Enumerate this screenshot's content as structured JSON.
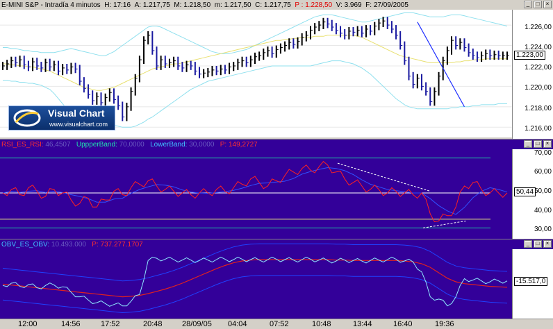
{
  "price_header": {
    "symbol": "E-MINI S&P - Intradía 4 minutos",
    "h_label": "H:",
    "h_val": "17:16",
    "a_label": "A:",
    "a_val": "1.217,75",
    "m_label": "M:",
    "m_val": "1.218,50",
    "mm_label": "m:",
    "mm_val": "1.217,50",
    "c_label": "C:",
    "c_val": "1.217,75",
    "p_label": "P :",
    "p_val": "1.228,50",
    "v_label": "V:",
    "v_val": "3.969",
    "f_label": "F:",
    "f_val": "27/09/2005"
  },
  "rsi_header": {
    "name": "RSI_ES_RSI:",
    "name_val": "46,4507",
    "upper": "UppperBand:",
    "upper_val": "70,0000",
    "lower": "LowerBand:",
    "lower_val": "30,0000",
    "p_label": "P:",
    "p_val": "149,2727"
  },
  "obv_header": {
    "name": "OBV_ES_OBV:",
    "name_val": "10.493.000",
    "p_label": "P:",
    "p_val": "737.277.1707"
  },
  "price_axis": [
    "1.226,00",
    "1.224,00",
    "1.222,00",
    "1.220,00",
    "1.218,00",
    "1.216,00"
  ],
  "rsi_axis": [
    "70,00",
    "60,00",
    "50,00",
    "40,00",
    "30,00"
  ],
  "price_current": "1.223,00",
  "rsi_current": "50,44",
  "obv_current": "-15.517,0",
  "x_labels": [
    "12:00",
    "14:56",
    "17:52",
    "20:48",
    "28/09/05",
    "04:04",
    "07:52",
    "10:48",
    "13:44",
    "16:40",
    "19:36"
  ],
  "logo": {
    "title": "Visual Chart",
    "url": "www.visualchart.com"
  },
  "window_buttons": [
    "_",
    "□",
    "×"
  ],
  "colors": {
    "price_bg": "#ffffff",
    "indicator_bg": "#330099",
    "price_bars": "#1a1aa0",
    "price_bars_up": "#000000",
    "bollinger": "#8fe0ee",
    "ma_yellow": "#e8e070",
    "rsi_line": "#ff2020",
    "rsi_band": "#20c0a0",
    "rsi_level": "#ffff80",
    "obv_line": "#8fe8ff",
    "obv_ma": "#e02020",
    "obv_env": "#2040ff"
  },
  "chart_data": [
    {
      "type": "line",
      "panel": "price",
      "ylim": [
        1215,
        1227.5
      ],
      "x": [
        0,
        6,
        12,
        18,
        24,
        30,
        36,
        42,
        48,
        54,
        60,
        66,
        72,
        78,
        84,
        90,
        96,
        102,
        108,
        114,
        120,
        126,
        132,
        138,
        144,
        150,
        156,
        162,
        168,
        174,
        180,
        186,
        192,
        198,
        204,
        210,
        216,
        222,
        228,
        234,
        240,
        246,
        252,
        258,
        264,
        270,
        276,
        282,
        288,
        294,
        300,
        306,
        312,
        318,
        324,
        330,
        336,
        342,
        348,
        354,
        360,
        366,
        372,
        378,
        384,
        390,
        396,
        402,
        408,
        414,
        420,
        426,
        432,
        438,
        444,
        450,
        456,
        462,
        468,
        474,
        480,
        486,
        492,
        498,
        504,
        510,
        516,
        522,
        528,
        534,
        540,
        546,
        552,
        558,
        564,
        570,
        576,
        582,
        588,
        594,
        600,
        606,
        612,
        618,
        624,
        630,
        636,
        642,
        648,
        654,
        660,
        666,
        672,
        678,
        684,
        690,
        696,
        702,
        708
      ],
      "close": [
        1222,
        1222.2,
        1222.5,
        1222.3,
        1222.6,
        1222.1,
        1221.9,
        1222.4,
        1222.0,
        1221.8,
        1222.3,
        1221.9,
        1222.1,
        1221.5,
        1221.8,
        1221.6,
        1221.9,
        1221.7,
        1220.5,
        1219.8,
        1219.2,
        1218.6,
        1219.0,
        1218.4,
        1218.9,
        1219.4,
        1218.7,
        1218.1,
        1217.0,
        1218.0,
        1219.5,
        1220.8,
        1222.6,
        1224.5,
        1225.0,
        1223.5,
        1222.0,
        1222.6,
        1222.2,
        1222.3,
        1222.5,
        1222.0,
        1221.8,
        1222.1,
        1222.0,
        1221.5,
        1221.2,
        1221.3,
        1221.4,
        1221.6,
        1221.5,
        1221.7,
        1221.6,
        1221.9,
        1222.0,
        1222.3,
        1222.5,
        1222.3,
        1222.6,
        1222.9,
        1223.0,
        1223.3,
        1223.5,
        1223.2,
        1223.6,
        1223.8,
        1224.0,
        1224.3,
        1224.1,
        1224.4,
        1224.8,
        1225.0,
        1225.5,
        1225.8,
        1226.0,
        1226.3,
        1226.1,
        1225.8,
        1225.5,
        1225.2,
        1225.0,
        1225.4,
        1225.3,
        1225.5,
        1225.2,
        1225.6,
        1225.4,
        1225.9,
        1226.2,
        1226.4,
        1226.0,
        1225.6,
        1225.0,
        1224.0,
        1222.5,
        1221.0,
        1220.2,
        1220.8,
        1220.0,
        1219.5,
        1218.5,
        1219.5,
        1221.0,
        1222.5,
        1223.5,
        1224.5,
        1224.0,
        1224.3,
        1223.8,
        1223.3,
        1223.0,
        1222.8,
        1223.0,
        1223.2,
        1223.0,
        1223.1,
        1223.0,
        1223.0,
        1223.0
      ],
      "ma": [
        1222.2,
        1222.2,
        1222.1,
        1222.1,
        1222.0,
        1222.0,
        1221.9,
        1221.9,
        1221.8,
        1221.7,
        1221.6,
        1221.5,
        1221.3,
        1221.1,
        1220.9,
        1220.7,
        1220.5,
        1220.3,
        1220.1,
        1219.9,
        1219.8,
        1219.7,
        1219.6,
        1219.6,
        1219.7,
        1219.8,
        1219.9,
        1220.1,
        1220.3,
        1220.5,
        1220.7,
        1220.9,
        1221.1,
        1221.3,
        1221.5,
        1221.7,
        1221.8,
        1221.9,
        1222.0,
        1222.1,
        1222.2,
        1222.2,
        1222.3,
        1222.4,
        1222.5,
        1222.6,
        1222.7,
        1222.8,
        1222.9,
        1223.0,
        1223.1,
        1223.2,
        1223.3,
        1223.4,
        1223.5,
        1223.6,
        1223.7,
        1223.8,
        1223.9,
        1224.0,
        1224.1,
        1224.2,
        1224.3,
        1224.4,
        1224.5,
        1224.5,
        1224.6,
        1224.6,
        1224.7,
        1224.7,
        1224.8,
        1224.8,
        1224.8,
        1224.9,
        1224.9,
        1224.9,
        1225.0,
        1225.0,
        1225.0,
        1225.0,
        1225.0,
        1225.0,
        1225.0,
        1224.9,
        1224.8,
        1224.6,
        1224.4,
        1224.2,
        1224.0,
        1223.8,
        1223.6,
        1223.4,
        1223.2,
        1223.0,
        1222.9,
        1222.8,
        1222.7,
        1222.6,
        1222.5,
        1222.4,
        1222.3,
        1222.3,
        1222.3,
        1222.3,
        1222.3,
        1222.3,
        1222.4,
        1222.4,
        1222.5,
        1222.5,
        1222.6,
        1222.6,
        1222.6,
        1222.7,
        1222.7,
        1222.7,
        1222.7,
        1222.7,
        1222.7
      ],
      "upper_band": [
        1223.8,
        1223.8,
        1223.7,
        1223.7,
        1223.6,
        1223.5,
        1223.5,
        1223.4,
        1223.4,
        1223.3,
        1223.3,
        1223.3,
        1223.3,
        1223.4,
        1223.5,
        1223.6,
        1223.7,
        1223.6,
        1223.5,
        1223.4,
        1223.3,
        1223.2,
        1223.1,
        1223.0,
        1223.0,
        1223.2,
        1223.4,
        1223.7,
        1224.0,
        1224.3,
        1224.6,
        1224.9,
        1225.2,
        1225.5,
        1225.8,
        1225.9,
        1225.9,
        1225.8,
        1225.6,
        1225.4,
        1225.2,
        1225.0,
        1224.8,
        1224.6,
        1224.4,
        1224.2,
        1224.0,
        1223.8,
        1223.6,
        1223.4,
        1223.3,
        1223.2,
        1223.2,
        1223.2,
        1223.3,
        1223.4,
        1223.5,
        1223.6,
        1223.8,
        1224.0,
        1224.2,
        1224.4,
        1224.6,
        1224.8,
        1225.0,
        1225.2,
        1225.4,
        1225.6,
        1225.8,
        1226.0,
        1226.2,
        1226.4,
        1226.6,
        1226.8,
        1226.9,
        1227.0,
        1227.0,
        1227.0,
        1226.9,
        1226.8,
        1226.7,
        1226.6,
        1226.5,
        1226.4,
        1226.3,
        1226.3,
        1226.4,
        1226.5,
        1226.6,
        1226.7,
        1226.8,
        1226.9,
        1227.0,
        1227.1,
        1227.2,
        1227.2,
        1227.2,
        1227.1,
        1227.0,
        1226.9,
        1226.8,
        1226.8,
        1226.8,
        1226.8,
        1226.9,
        1227.0,
        1227.0,
        1227.0,
        1226.9,
        1226.8,
        1226.7,
        1226.6,
        1226.5,
        1226.4,
        1226.3,
        1226.2,
        1226.1,
        1226.0,
        1225.9
      ],
      "lower_band": [
        1220.6,
        1220.6,
        1220.5,
        1220.5,
        1220.4,
        1220.4,
        1220.3,
        1220.3,
        1220.2,
        1220.1,
        1219.9,
        1219.7,
        1219.3,
        1218.8,
        1218.3,
        1217.8,
        1217.4,
        1217.0,
        1216.7,
        1216.4,
        1216.2,
        1216.1,
        1216.0,
        1216.1,
        1216.2,
        1216.3,
        1216.2,
        1216.1,
        1216.0,
        1216.0,
        1216.0,
        1216.1,
        1216.3,
        1216.5,
        1216.8,
        1217.0,
        1217.3,
        1217.6,
        1217.9,
        1218.2,
        1218.5,
        1218.8,
        1219.1,
        1219.4,
        1219.7,
        1219.9,
        1220.1,
        1220.3,
        1220.5,
        1220.6,
        1220.7,
        1220.8,
        1220.9,
        1221.0,
        1221.1,
        1221.2,
        1221.3,
        1221.4,
        1221.5,
        1221.6,
        1221.7,
        1221.8,
        1221.9,
        1222.0,
        1222.0,
        1222.0,
        1222.0,
        1222.0,
        1222.0,
        1222.0,
        1222.0,
        1222.0,
        1222.0,
        1222.1,
        1222.2,
        1222.3,
        1222.4,
        1222.5,
        1222.5,
        1222.5,
        1222.4,
        1222.3,
        1222.2,
        1222.0,
        1221.8,
        1221.5,
        1221.2,
        1220.8,
        1220.4,
        1220.0,
        1219.6,
        1219.2,
        1218.8,
        1218.5,
        1218.2,
        1218.0,
        1217.9,
        1217.8,
        1217.8,
        1217.8,
        1217.8,
        1217.8,
        1217.8,
        1217.8,
        1217.8,
        1217.9,
        1217.9,
        1218.0,
        1218.0,
        1218.0,
        1218.1,
        1218.1,
        1218.2,
        1218.2,
        1218.2,
        1218.2,
        1218.3,
        1218.3,
        1218.3
      ]
    },
    {
      "type": "line",
      "panel": "rsi",
      "ylim": [
        25,
        75
      ],
      "levels": [
        70,
        50,
        35,
        30
      ],
      "x": [
        0,
        12,
        24,
        36,
        48,
        60,
        72,
        84,
        96,
        108,
        120,
        132,
        144,
        156,
        168,
        180,
        192,
        204,
        216,
        228,
        240,
        252,
        264,
        276,
        288,
        300,
        312,
        324,
        336,
        348,
        360,
        372,
        384,
        396,
        408,
        420,
        432,
        444,
        456,
        468,
        480,
        492,
        504,
        516,
        528,
        540,
        552,
        564,
        576,
        588,
        600,
        612,
        624,
        636,
        648,
        660,
        672,
        684,
        696,
        708
      ],
      "values": [
        50,
        52,
        49,
        53,
        51,
        48,
        52,
        50,
        46,
        44,
        47,
        42,
        46,
        51,
        49,
        53,
        55,
        57,
        54,
        52,
        51,
        50,
        49,
        50,
        50,
        52,
        51,
        53,
        55,
        58,
        56,
        54,
        57,
        60,
        62,
        64,
        63,
        65,
        66,
        62,
        58,
        56,
        54,
        52,
        52,
        50,
        51,
        50,
        49,
        50,
        38,
        34,
        37,
        42,
        54,
        56,
        52,
        50,
        50,
        50
      ]
    },
    {
      "type": "line",
      "panel": "obv",
      "x": [
        0,
        12,
        24,
        36,
        48,
        60,
        72,
        84,
        96,
        108,
        120,
        132,
        144,
        156,
        168,
        180,
        192,
        204,
        216,
        228,
        240,
        252,
        264,
        276,
        288,
        300,
        312,
        324,
        336,
        348,
        360,
        372,
        384,
        396,
        408,
        420,
        432,
        444,
        456,
        468,
        480,
        492,
        504,
        516,
        528,
        540,
        552,
        564,
        576,
        588,
        600,
        612,
        624,
        636,
        648,
        660,
        672,
        684,
        696,
        708
      ],
      "values": [
        -15000,
        -14500,
        -15200,
        -14800,
        -15500,
        -15000,
        -14900,
        -15300,
        -16500,
        -17500,
        -18200,
        -18800,
        -19000,
        -19200,
        -19500,
        -18500,
        -17000,
        -9500,
        -9000,
        -9200,
        -9300,
        -9400,
        -9400,
        -9500,
        -9400,
        -9300,
        -9200,
        -9300,
        -9200,
        -9300,
        -9400,
        -9300,
        -9200,
        -9300,
        -9400,
        -9300,
        -9200,
        -9400,
        -9500,
        -9600,
        -9400,
        -9500,
        -9600,
        -9500,
        -9400,
        -9300,
        -9200,
        -9600,
        -9800,
        -12000,
        -17500,
        -18000,
        -19500,
        -17500,
        -13500,
        -13800,
        -14000,
        -14200,
        -14000,
        -14000
      ],
      "ma": [
        -14700,
        -14900,
        -15100,
        -15300,
        -15500,
        -15700,
        -15900,
        -16100,
        -16300,
        -16500,
        -16700,
        -16900,
        -17100,
        -17300,
        -17500,
        -17400,
        -17200,
        -16800,
        -16300,
        -15800,
        -15200,
        -14500,
        -13700,
        -12900,
        -12100,
        -11300,
        -10600,
        -10000,
        -9600,
        -9400,
        -9300,
        -9300,
        -9300,
        -9300,
        -9300,
        -9300,
        -9300,
        -9300,
        -9300,
        -9400,
        -9400,
        -9500,
        -9500,
        -9500,
        -9500,
        -9500,
        -9500,
        -9600,
        -9800,
        -10200,
        -11000,
        -12200,
        -13400,
        -14200,
        -14600,
        -14800,
        -15000,
        -15200,
        -15300,
        -15400
      ]
    }
  ]
}
